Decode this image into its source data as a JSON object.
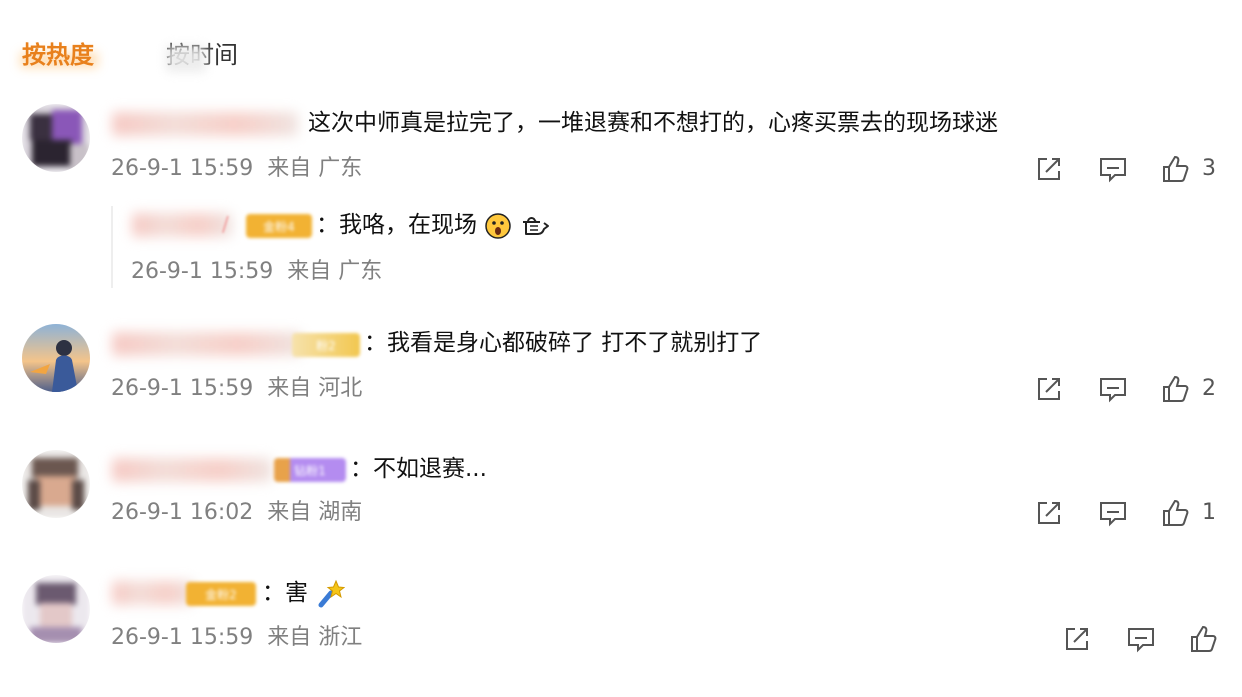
{
  "sort_tabs": {
    "hot": "按热度",
    "time": "按时间"
  },
  "comments": [
    {
      "text": "这次中师真是拉完了，一堆退赛和不想打的，心疼买票去的现场球迷",
      "time": "26-9-1 15:59",
      "location": "来自 广东",
      "likes": "3",
      "reply": {
        "badge": "金粉4",
        "text": "：我咯，在现场",
        "time": "26-9-1 15:59",
        "location": "来自 广东"
      }
    },
    {
      "badge": "粉2",
      "text": "：我看是身心都破碎了 打不了就别打了",
      "time": "26-9-1 15:59",
      "location": "来自 河北",
      "likes": "2"
    },
    {
      "badge": "钻粉1",
      "text": "：不如退赛...",
      "time": "26-9-1 16:02",
      "location": "来自 湖南",
      "likes": "1"
    },
    {
      "badge": "金粉2",
      "text": "：害",
      "time": "26-9-1 15:59",
      "location": "来自 浙江",
      "likes": ""
    }
  ],
  "icons": {
    "share": "share-icon",
    "comment": "comment-icon",
    "like": "thumbs-up-icon"
  },
  "colors": {
    "hot_tab": "#e8801c",
    "meta_text": "#808080",
    "gold_badge": "#f2b233",
    "purple_badge": "#b48cf0"
  }
}
